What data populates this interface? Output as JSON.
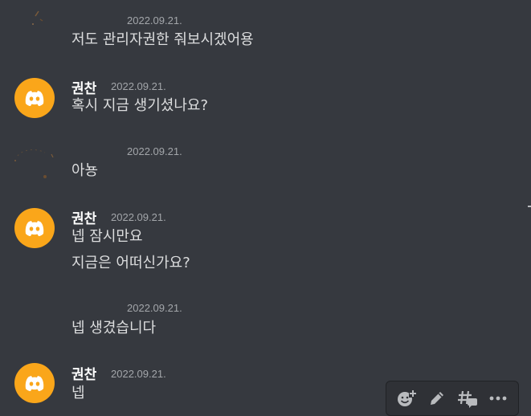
{
  "messages": [
    {
      "time": "2022.09.21.",
      "text": "저도 관리자권한 줘보시겠어용"
    },
    {
      "author": "권찬",
      "time": "2022.09.21.",
      "text": "혹시 지금 생기셨나요?"
    },
    {
      "time": "2022.09.21.",
      "text": "아뇽"
    },
    {
      "author": "권찬",
      "time": "2022.09.21.",
      "text": "넵 잠시만요",
      "text2": "지금은 어떠신가요?"
    },
    {
      "time": "2022.09.21.",
      "text": "넵 생겼습니다"
    },
    {
      "author": "권찬",
      "time": "2022.09.21.",
      "text": "넵"
    }
  ],
  "colors": {
    "background": "#36393f",
    "avatar": "#faa61a",
    "text": "#dcddde",
    "timestamp": "#a3a6aa"
  },
  "toolbar": {
    "icons": [
      "add-reaction-icon",
      "pencil-icon",
      "thread-icon",
      "more-icon"
    ]
  }
}
